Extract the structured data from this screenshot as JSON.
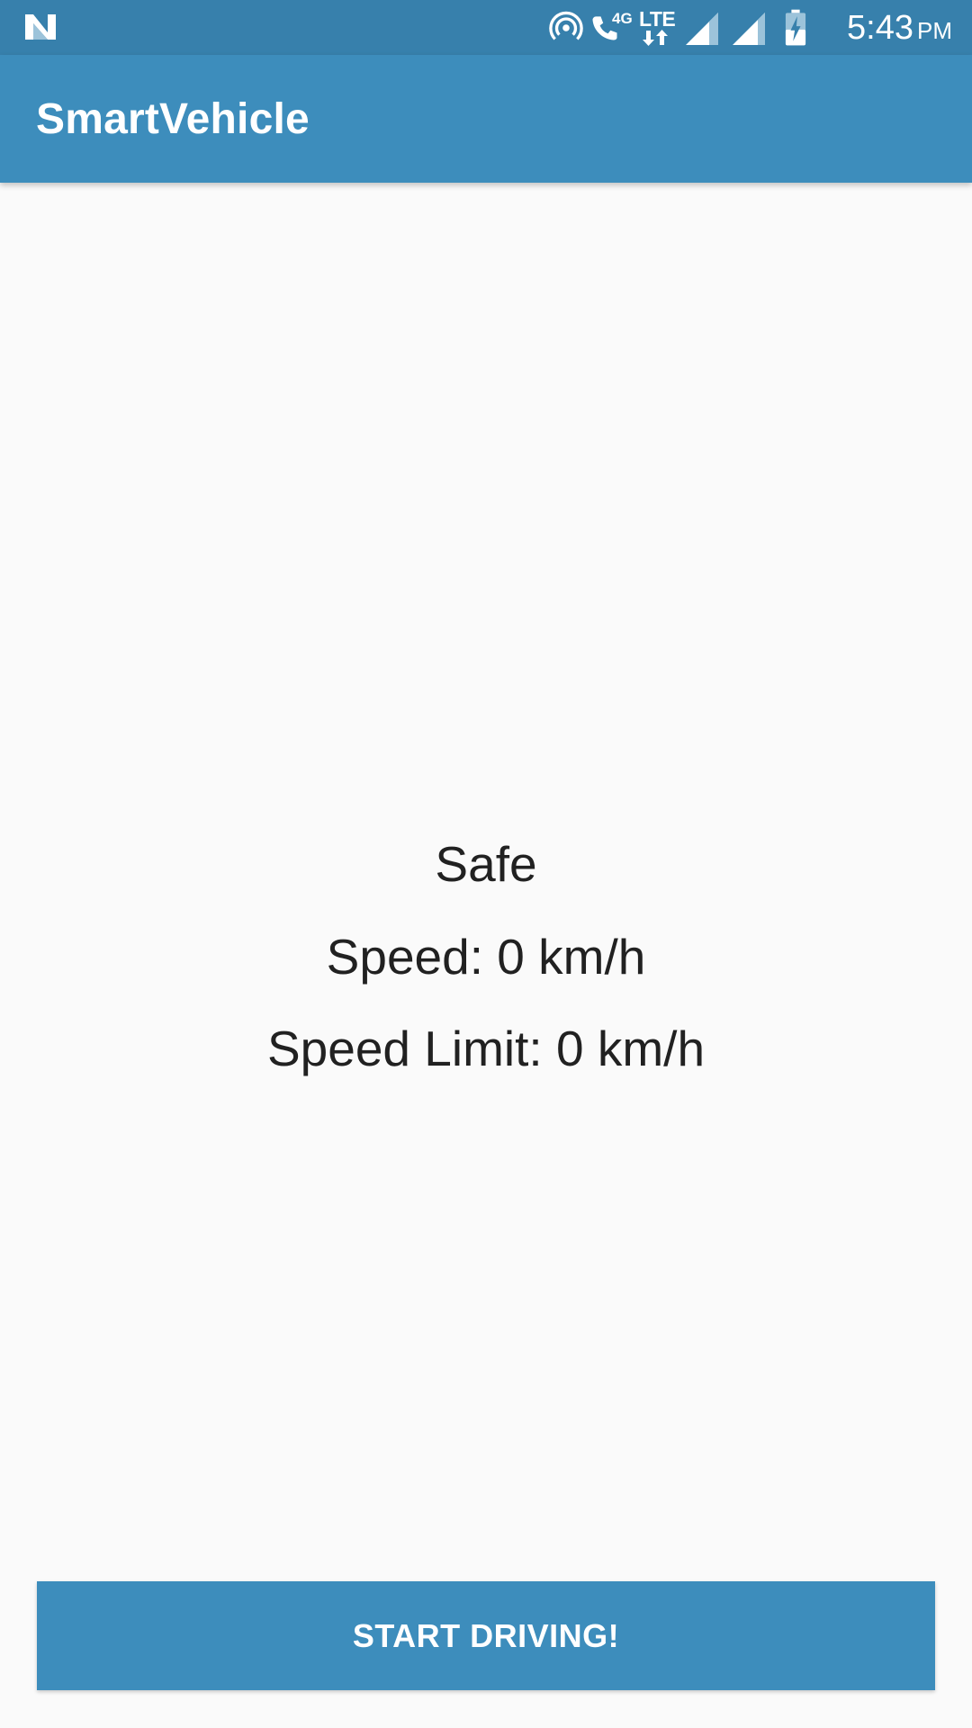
{
  "status_bar": {
    "time": "5:43",
    "ampm": "PM",
    "network_4g": "4G",
    "network_lte": "LTE",
    "icons": [
      "notification-n-icon",
      "hotspot-icon",
      "volte-call-icon",
      "lte-data-icon",
      "signal-icon",
      "signal-icon",
      "battery-charging-icon"
    ]
  },
  "app_bar": {
    "title": "SmartVehicle"
  },
  "main": {
    "status": "Safe",
    "speed": "Speed: 0 km/h",
    "speed_limit": "Speed Limit: 0 km/h"
  },
  "actions": {
    "start_label": "START DRIVING!"
  },
  "colors": {
    "status_bar": "#3780ac",
    "primary": "#3d8dbc",
    "background": "#fafafa",
    "text": "#212121"
  }
}
